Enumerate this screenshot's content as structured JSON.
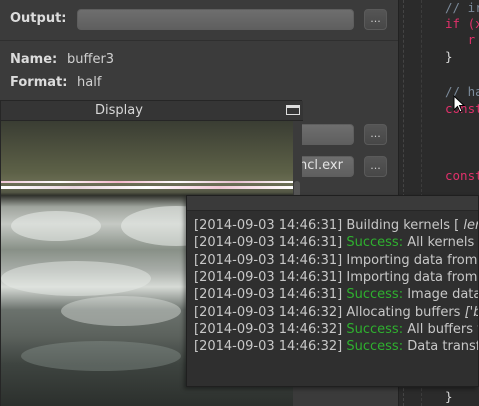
{
  "properties": {
    "output_label": "Output:",
    "output_value": "",
    "browse_label": "...",
    "name_label": "Name:",
    "name_value": "buffer3",
    "format_label": "Format:",
    "format_value": "half",
    "hidden_field_value": "ncl.exr"
  },
  "display": {
    "title": "Display"
  },
  "code": {
    "lines": [
      {
        "text": "// ir",
        "kind": "comment"
      },
      {
        "text": "if (x",
        "kind": "kw"
      },
      {
        "text": "   r",
        "kind": "kw"
      },
      {
        "text": "}",
        "kind": "plain"
      },
      {
        "text": "// ha",
        "kind": "comment"
      },
      {
        "text": "const",
        "kind": "kw"
      },
      {
        "text": "const",
        "kind": "kw"
      },
      {
        "text": "}",
        "kind": "plain"
      }
    ]
  },
  "log": {
    "lines": [
      {
        "time": "[2014-09-03 14:46:31]",
        "status": "",
        "message": "Building kernels [ ",
        "extra": "ler"
      },
      {
        "time": "[2014-09-03 14:46:31]",
        "status": "Success:",
        "message": "All kernels",
        "extra": ""
      },
      {
        "time": "[2014-09-03 14:46:31]",
        "status": "",
        "message": "Importing data from",
        "extra": ""
      },
      {
        "time": "[2014-09-03 14:46:31]",
        "status": "",
        "message": "Importing data from",
        "extra": ""
      },
      {
        "time": "[2014-09-03 14:46:31]",
        "status": "Success:",
        "message": "Image data",
        "extra": ""
      },
      {
        "time": "[2014-09-03 14:46:32]",
        "status": "",
        "message": "Allocating buffers ",
        "extra": "['b"
      },
      {
        "time": "[2014-09-03 14:46:32]",
        "status": "Success:",
        "message": "All buffers v",
        "extra": ""
      },
      {
        "time": "[2014-09-03 14:46:32]",
        "status": "Success:",
        "message": "Data transf",
        "extra": ""
      }
    ]
  },
  "colors": {
    "success": "#2fb02f",
    "keyword": "#e0306a",
    "comment": "#7b8a9a"
  }
}
